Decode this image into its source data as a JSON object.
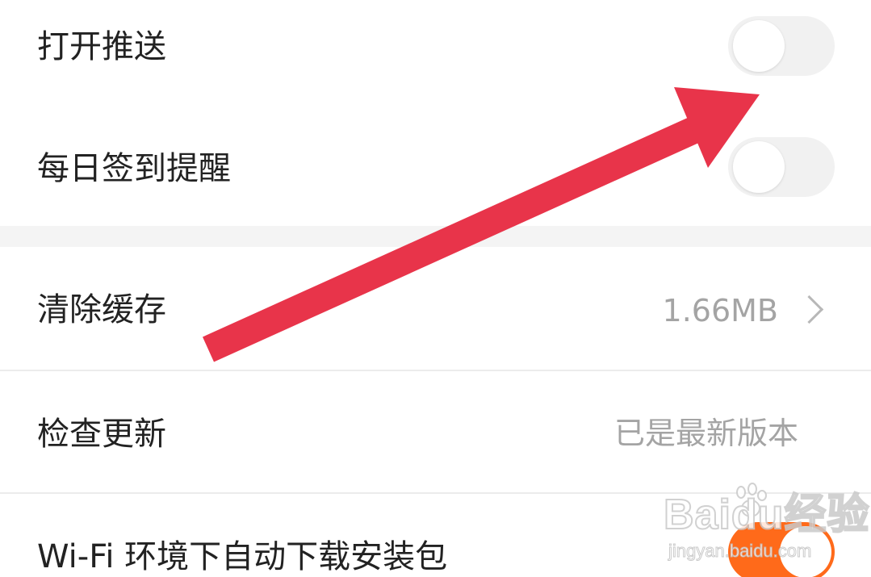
{
  "settings": {
    "push": {
      "label": "打开推送",
      "enabled": false
    },
    "checkin_reminder": {
      "label": "每日签到提醒",
      "enabled": false
    },
    "clear_cache": {
      "label": "清除缓存",
      "value": "1.66MB"
    },
    "check_update": {
      "label": "检查更新",
      "value": "已是最新版本"
    },
    "wifi_auto_download": {
      "label": "Wi-Fi 环境下自动下载安装包",
      "enabled": true
    }
  },
  "watermark": {
    "brand": "Baidu经验",
    "url": "jingyan.baidu.com"
  },
  "colors": {
    "toggle_on": "#ff6a1a",
    "toggle_off": "#f1f1f1",
    "annotation_arrow": "#e8344a",
    "label_text": "#222222",
    "secondary_text": "#a4a4a4"
  },
  "icons": {
    "chevron": "chevron-right-icon",
    "annotation": "red-arrow-annotation-icon"
  }
}
